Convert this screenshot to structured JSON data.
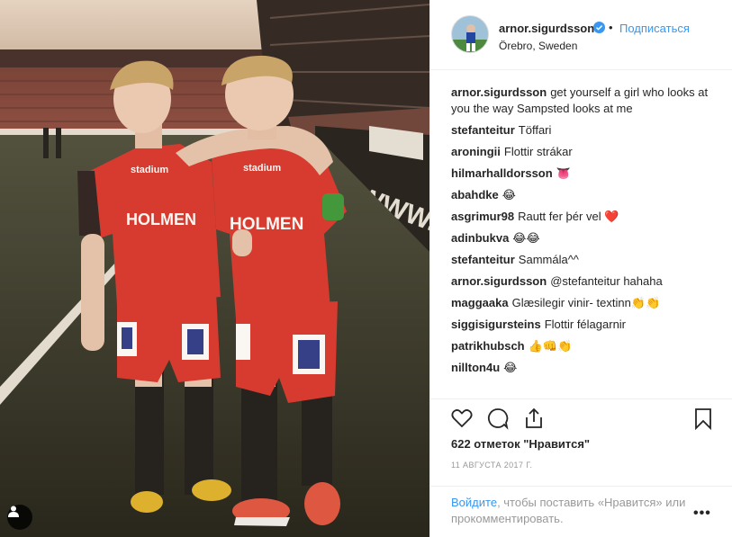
{
  "header": {
    "username": "arnor.sigurdsson",
    "follow_label": "Подписаться",
    "dot": "•",
    "location": "Örebro, Sweden"
  },
  "comments": [
    {
      "user": "arnor.sigurdsson",
      "text": "get yourself a girl who looks at you the way Sampsted looks at me"
    },
    {
      "user": "stefanteitur",
      "text": "Töffari"
    },
    {
      "user": "aroningii",
      "text": "Flottir strákar"
    },
    {
      "user": "hilmarhalldorsson",
      "text": "👅"
    },
    {
      "user": "abahdke",
      "text": "😂"
    },
    {
      "user": "asgrimur98",
      "text": "Rautt fer þér vel ❤️"
    },
    {
      "user": "adinbukva",
      "text": "😂😂"
    },
    {
      "user": "stefanteitur",
      "text": "Sammála^^"
    },
    {
      "user": "arnor.sigurdsson",
      "text": "@stefanteitur hahaha"
    },
    {
      "user": "maggaaka",
      "text": "Glæsilegir vinir- textinn👏👏"
    },
    {
      "user": "siggisigursteins",
      "text": "Flottir félagarnir"
    },
    {
      "user": "patrikhubsch",
      "text": "👍👊👏"
    },
    {
      "user": "nillton4u",
      "text": "😂"
    }
  ],
  "actions": {
    "like_icon": "heart-icon",
    "comment_icon": "comment-icon",
    "share_icon": "share-icon",
    "save_icon": "bookmark-icon"
  },
  "likes": "622 отметок \"Нравится\"",
  "date": "11 АВГУСТА 2017 Г.",
  "login": {
    "link": "Войдите",
    "text": ", чтобы поставить «Нравится» или прокомментировать."
  },
  "more": "•••",
  "photo": {
    "shirt_text_left": "HOLMEN",
    "shirt_text_right": "HOLMEN",
    "sponsor": "stadium",
    "board_text": "WWW.LEDVE"
  },
  "colors": {
    "accent": "#3897f0",
    "shirt_red": "#d9342b"
  }
}
